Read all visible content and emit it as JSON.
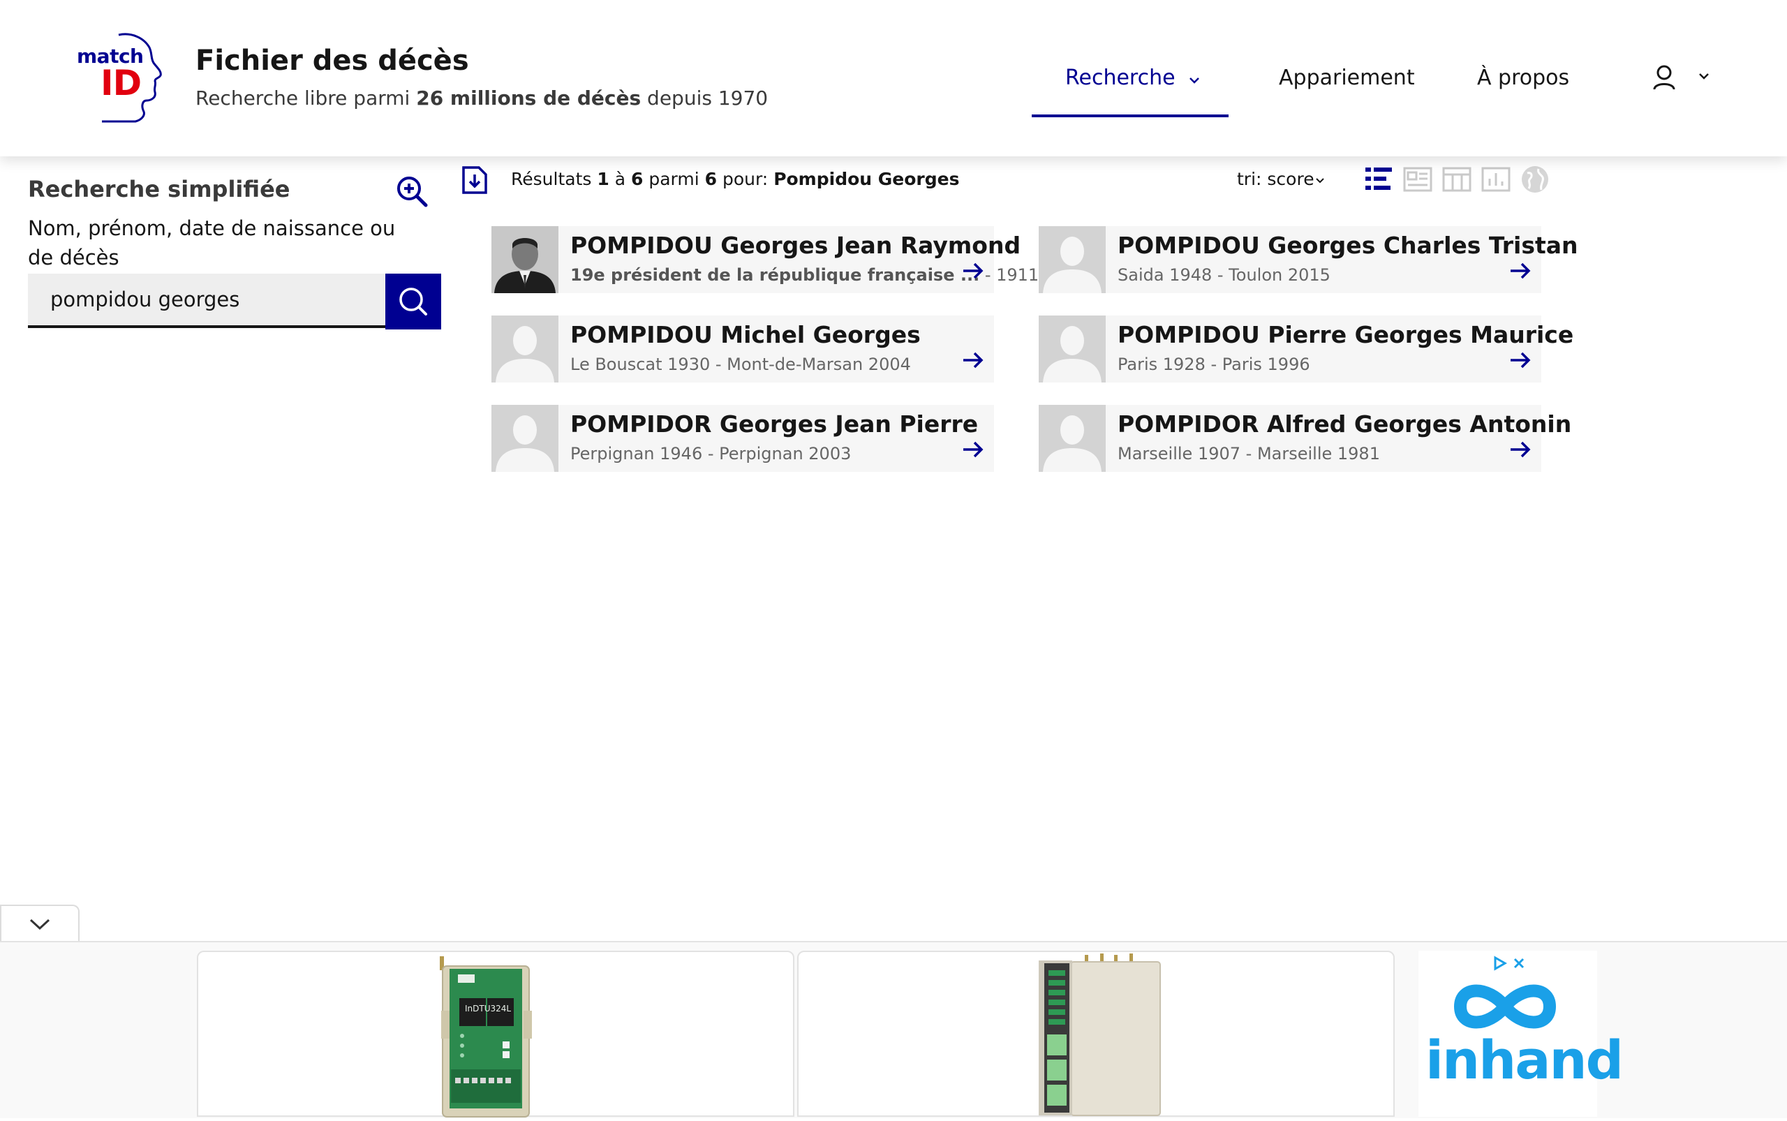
{
  "header": {
    "logo_match": "match",
    "logo_id": "ID",
    "title": "Fichier des décès",
    "subtitle_prefix": "Recherche libre parmi ",
    "subtitle_bold": "26 millions de décès",
    "subtitle_suffix": " depuis 1970",
    "nav": {
      "recherche": "Recherche",
      "appariement": "Appariement",
      "apropos": "À propos"
    },
    "brand_color": "#000091",
    "accent_color": "#e1000f"
  },
  "sidebar": {
    "title": "Recherche simplifiée",
    "label": "Nom, prénom, date de naissance ou de décès",
    "search_value": "pompidou georges"
  },
  "results": {
    "prefix": "Résultats ",
    "from": "1",
    "to_word": " à ",
    "to": "6",
    "of_word": " parmi ",
    "total": "6",
    "for_word": " pour: ",
    "query": "Pompidou Georges",
    "sort_label": "tri: score",
    "views": [
      "list-view-icon",
      "card-view-icon",
      "table-view-icon",
      "chart-view-icon",
      "map-view-icon"
    ],
    "items": [
      {
        "name": "POMPIDOU Georges Jean Raymond",
        "sub_bold": "19e président de la république française ...",
        "sub": " - 1911 -",
        "photo": true
      },
      {
        "name": "POMPIDOU Georges Charles Tristan",
        "sub_bold": "",
        "sub": "Saida 1948 - Toulon 2015",
        "photo": false
      },
      {
        "name": "POMPIDOU Michel Georges",
        "sub_bold": "",
        "sub": "Le Bouscat 1930 - Mont-de-Marsan 2004",
        "photo": false
      },
      {
        "name": "POMPIDOU Pierre Georges Maurice",
        "sub_bold": "",
        "sub": "Paris 1928 - Paris 1996",
        "photo": false
      },
      {
        "name": "POMPIDOR Georges Jean Pierre",
        "sub_bold": "",
        "sub": "Perpignan 1946 - Perpignan 2003",
        "photo": false
      },
      {
        "name": "POMPIDOR Alfred Georges Antonin",
        "sub_bold": "",
        "sub": "Marseille 1907 - Marseille 1981",
        "photo": false
      }
    ]
  },
  "ad": {
    "brand": "inhand",
    "device1_label": "InDTU324L",
    "brand_color": "#1aa0e8"
  }
}
